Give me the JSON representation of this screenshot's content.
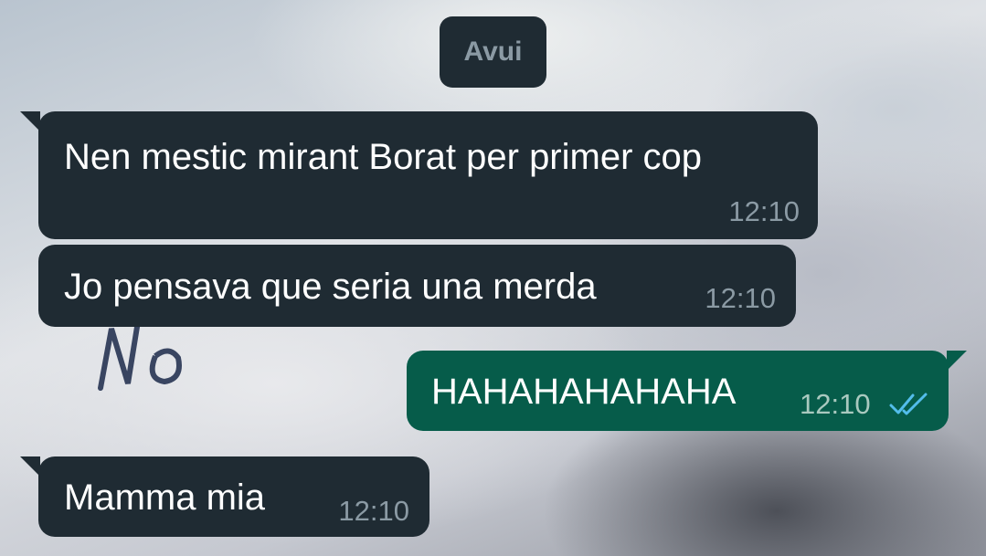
{
  "date_separator": "Avui",
  "messages": [
    {
      "direction": "incoming",
      "text": "Nen mestic mirant Borat per primer cop",
      "time": "12:10"
    },
    {
      "direction": "incoming",
      "text": "Jo pensava que seria una merda",
      "time": "12:10"
    },
    {
      "direction": "outgoing",
      "text": "HAHAHAHAHAHA",
      "time": "12:10",
      "status_icon": "double-check-read-icon"
    },
    {
      "direction": "incoming",
      "text": "Mamma mia",
      "time": "12:10"
    }
  ],
  "colors": {
    "incoming_bubble": "#1f2b33",
    "outgoing_bubble": "#065c4a",
    "timestamp": "#8b9aa4",
    "read_ticks": "#53bdeb"
  }
}
